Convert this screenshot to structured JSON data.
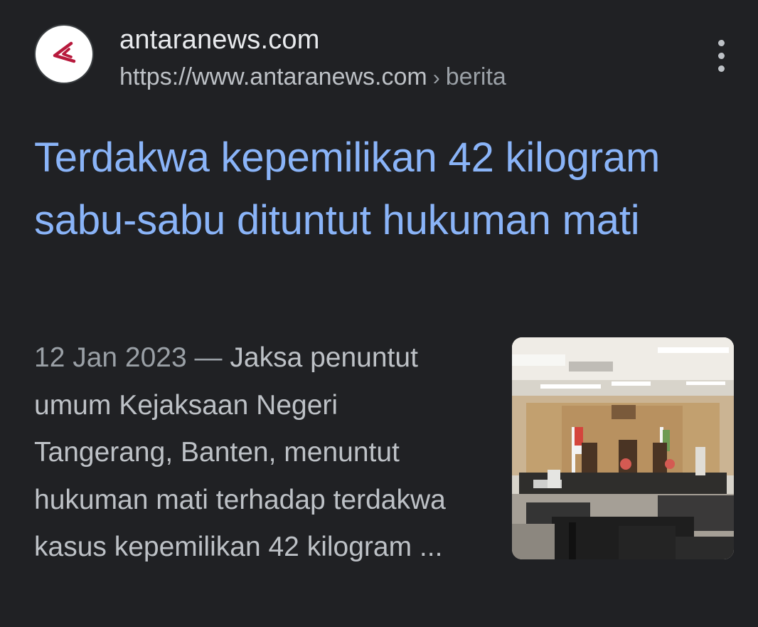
{
  "source": {
    "site_name": "antaranews.com",
    "url_base": "https://www.antaranews.com",
    "url_separator": "›",
    "url_path": "berita",
    "favicon_icon": "antara-logo-icon",
    "more_icon": "more-vert-icon"
  },
  "result": {
    "title": "Terdakwa kepemilikan 42 kilogram sabu-sabu dituntut hukuman mati",
    "date": "12 Jan 2023",
    "date_separator": " — ",
    "snippet": "Jaksa penuntut umum Kejaksaan Negeri Tangerang, Banten, menuntut hukuman mati terhadap terdakwa kasus kepemilikan 42 kilogram ...",
    "thumbnail_icon": "courtroom-thumbnail"
  },
  "colors": {
    "background": "#202124",
    "title_link": "#8ab4f8",
    "site_name": "#e8eaed",
    "url_text": "#bdc1c6",
    "snippet_text": "#bdc1c6",
    "logo_accent": "#b7193c"
  }
}
